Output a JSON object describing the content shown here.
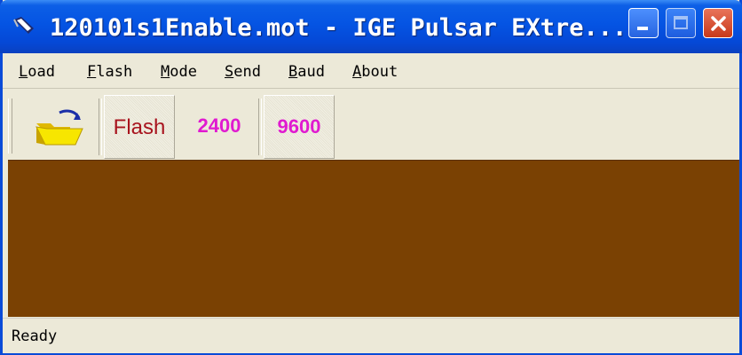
{
  "window": {
    "title": "120101s1Enable.mot - IGE Pulsar EXtre..."
  },
  "title_buttons": {
    "minimize": "minimize",
    "maximize": "maximize",
    "close": "close"
  },
  "menu": [
    {
      "accel": "L",
      "rest": "oad"
    },
    {
      "accel": "F",
      "rest": "lash"
    },
    {
      "accel": "M",
      "rest": "ode"
    },
    {
      "accel": "S",
      "rest": "end"
    },
    {
      "accel": "B",
      "rest": "aud"
    },
    {
      "accel": "A",
      "rest": "bout"
    }
  ],
  "toolbar": {
    "open_icon": "folder-open-icon",
    "flash_label": "Flash",
    "baud_2400_label": "2400",
    "baud_9600_label": "9600",
    "flash_color": "#a8141e",
    "baud_color": "#e01ad0"
  },
  "content": {
    "background": "#7a4103"
  },
  "status": {
    "text": "Ready"
  }
}
